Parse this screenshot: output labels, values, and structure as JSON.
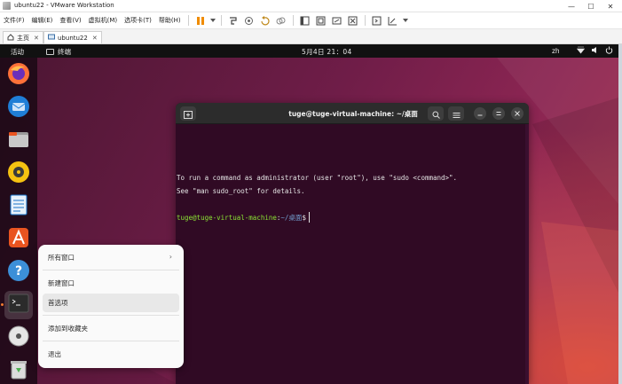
{
  "window": {
    "title": "ubuntu22 - VMware Workstation",
    "controls": [
      "—",
      "☐",
      "✕"
    ]
  },
  "menubar": {
    "menus": [
      "文件(F)",
      "编辑(E)",
      "查看(V)",
      "虚拟机(M)",
      "选项卡(T)",
      "帮助(H)"
    ]
  },
  "vm_tabs": [
    {
      "label": "主页",
      "icon": "home-icon"
    },
    {
      "label": "ubuntu22",
      "icon": "vm-icon"
    }
  ],
  "topbar": {
    "activities": "活动",
    "app_name": "终端",
    "clock": "5月4日 21：04",
    "language": "zh"
  },
  "dock": {
    "items": [
      {
        "name": "firefox",
        "icon": "firefox-icon"
      },
      {
        "name": "thunderbird",
        "icon": "thunderbird-icon"
      },
      {
        "name": "files",
        "icon": "files-icon"
      },
      {
        "name": "rhythmbox",
        "icon": "rhythmbox-icon"
      },
      {
        "name": "libreoffice-writer",
        "icon": "writer-icon"
      },
      {
        "name": "software",
        "icon": "software-icon"
      },
      {
        "name": "help",
        "icon": "help-icon"
      },
      {
        "name": "terminal",
        "icon": "terminal-icon",
        "active": true
      },
      {
        "name": "dvd",
        "icon": "disc-icon"
      },
      {
        "name": "trash",
        "icon": "trash-icon"
      }
    ]
  },
  "terminal": {
    "title": "tuge@tuge-virtual-machine: ~/桌面",
    "lines": [
      "To run a command as administrator (user \"root\"), use \"sudo <command>\".",
      "See \"man sudo_root\" for details."
    ],
    "prompt": {
      "user_host": "tuge@tuge-virtual-machine",
      "sep": ":",
      "path": "~/桌面",
      "symbol": "$"
    }
  },
  "context_menu": {
    "items": [
      {
        "label": "所有窗口",
        "submenu": true
      },
      {
        "label": "新建窗口"
      },
      {
        "label": "首选项",
        "highlighted": true
      },
      {
        "label": "添加到收藏夹"
      },
      {
        "label": "退出"
      }
    ]
  },
  "colors": {
    "terminal_bg": "#300a24",
    "prompt_user": "#8ae234",
    "prompt_path": "#729fcf",
    "topbar_bg": "#111111",
    "accent_orange": "#e95420"
  }
}
